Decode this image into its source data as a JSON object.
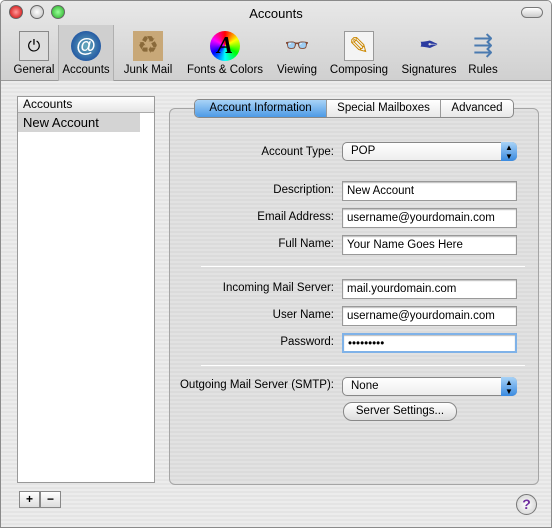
{
  "window": {
    "title": "Accounts"
  },
  "toolbar": [
    {
      "label": "General",
      "icon": "switch-icon",
      "glyph": "⏻"
    },
    {
      "label": "Accounts",
      "icon": "at-icon",
      "glyph": "@"
    },
    {
      "label": "Junk Mail",
      "icon": "junk-mail-icon",
      "glyph": "♻"
    },
    {
      "label": "Fonts & Colors",
      "icon": "fonts-colors-icon",
      "glyph": "A"
    },
    {
      "label": "Viewing",
      "icon": "glasses-icon",
      "glyph": "👓"
    },
    {
      "label": "Composing",
      "icon": "pencil-paper-icon",
      "glyph": "✎"
    },
    {
      "label": "Signatures",
      "icon": "pen-icon",
      "glyph": "✒"
    },
    {
      "label": "Rules",
      "icon": "rules-icon",
      "glyph": "⇶"
    }
  ],
  "accounts_list": {
    "header": "Accounts",
    "items": [
      "New Account"
    ],
    "add": "+",
    "remove": "−"
  },
  "tabs": [
    "Account Information",
    "Special Mailboxes",
    "Advanced"
  ],
  "form": {
    "account_type_label": "Account Type:",
    "account_type": "POP",
    "description_label": "Description:",
    "description": "New Account",
    "email_label": "Email Address:",
    "email": "username@yourdomain.com",
    "fullname_label": "Full Name:",
    "fullname": "Your Name Goes Here",
    "incoming_label": "Incoming Mail Server:",
    "incoming": "mail.yourdomain.com",
    "username_label": "User Name:",
    "username": "username@yourdomain.com",
    "password_label": "Password:",
    "password": "•••••••••",
    "smtp_label": "Outgoing Mail Server (SMTP):",
    "smtp": "None",
    "server_settings": "Server Settings..."
  },
  "help": "?",
  "colors": {
    "accent": "#4d9ae6",
    "help": "#7030a0"
  }
}
